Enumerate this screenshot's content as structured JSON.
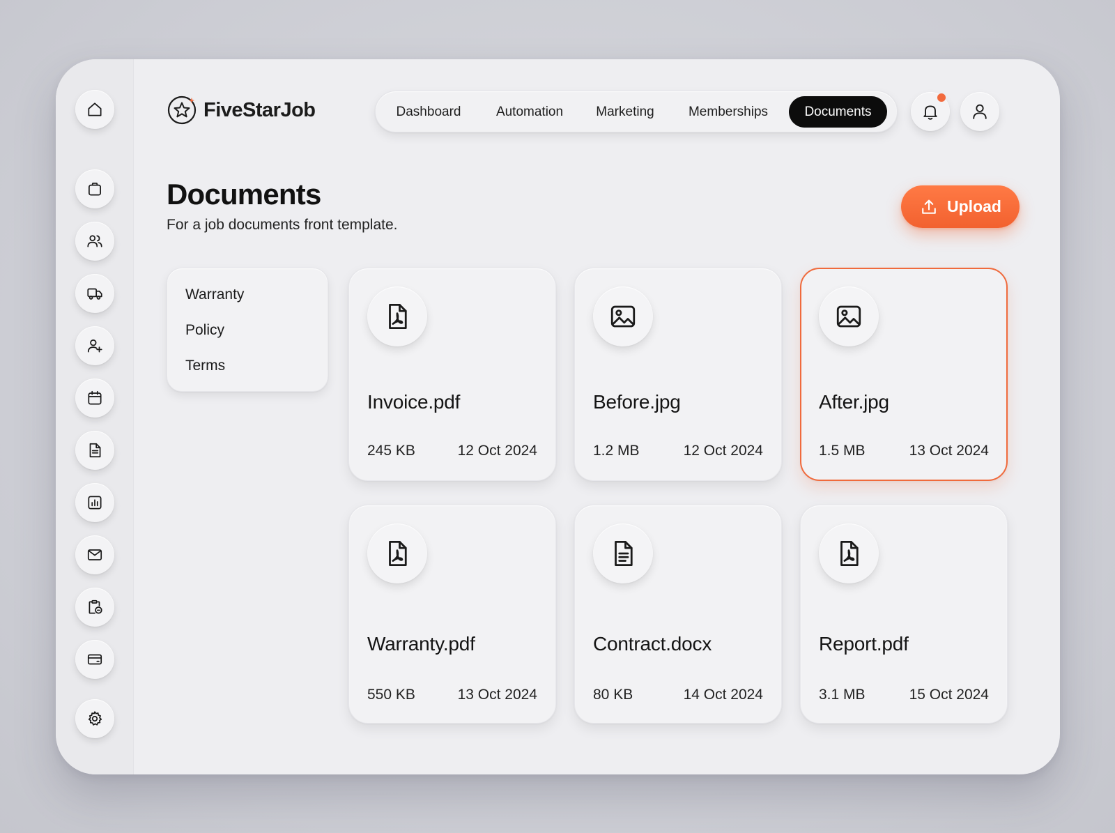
{
  "app": {
    "name": "FiveStarJob"
  },
  "nav": {
    "items": [
      {
        "label": "Dashboard"
      },
      {
        "label": "Automation"
      },
      {
        "label": "Marketing"
      },
      {
        "label": "Memberships"
      },
      {
        "label": "Documents",
        "active": true
      }
    ]
  },
  "page": {
    "title": "Documents",
    "subtitle": "For a job documents front template."
  },
  "upload_button": {
    "label": "Upload"
  },
  "filters": [
    {
      "label": "Warranty"
    },
    {
      "label": "Policy"
    },
    {
      "label": "Terms"
    }
  ],
  "documents": [
    {
      "name": "Invoice.pdf",
      "size": "245 KB",
      "date": "12 Oct 2024",
      "icon": "pdf-icon"
    },
    {
      "name": "Before.jpg",
      "size": "1.2 MB",
      "date": "12 Oct 2024",
      "icon": "image-icon"
    },
    {
      "name": "After.jpg",
      "size": "1.5 MB",
      "date": "13 Oct 2024",
      "icon": "image-icon",
      "selected": true
    },
    {
      "name": "Warranty.pdf",
      "size": "550 KB",
      "date": "13 Oct 2024",
      "icon": "pdf-icon"
    },
    {
      "name": "Contract.docx",
      "size": "80 KB",
      "date": "14 Oct 2024",
      "icon": "doc-icon"
    },
    {
      "name": "Report.pdf",
      "size": "3.1 MB",
      "date": "15 Oct 2024",
      "icon": "pdf-icon"
    }
  ],
  "sidebar": {
    "icons": [
      "home-icon",
      "briefcase-icon",
      "users-icon",
      "truck-icon",
      "user-plus-icon",
      "calendar-icon",
      "document-icon",
      "chart-icon",
      "mail-icon",
      "clipboard-icon",
      "card-icon",
      "settings-icon"
    ]
  },
  "colors": {
    "accent": "#f26a3d",
    "active_nav": "#0c0c0c",
    "background": "#eeeef1"
  }
}
